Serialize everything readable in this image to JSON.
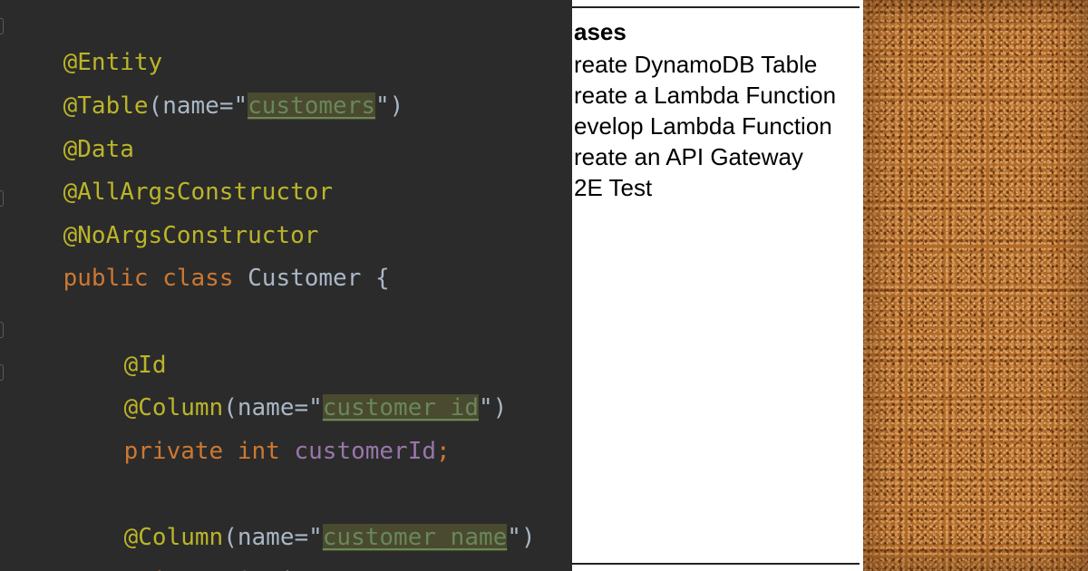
{
  "editor": {
    "lines": {
      "l1": {
        "ann": "@Entity"
      },
      "l2": {
        "ann": "@Table",
        "open": "(name=\"",
        "value": "customers",
        "close": "\")"
      },
      "l3": {
        "ann": "@Data"
      },
      "l4": {
        "ann": "@AllArgsConstructor"
      },
      "l5": {
        "ann": "@NoArgsConstructor"
      },
      "l6": {
        "kw1": "public",
        "kw2": "class",
        "name": "Customer",
        "brace": "{"
      },
      "l7": {
        "ann": "@Id"
      },
      "l8": {
        "ann": "@Column",
        "open": "(name=\"",
        "value": "customer_id",
        "close": "\")"
      },
      "l9": {
        "kw1": "private",
        "kw2": "int",
        "field": "customerId",
        "end": ";"
      },
      "l10": {
        "ann": "@Column",
        "open": "(name=\"",
        "value": "customer_name",
        "close": "\")"
      },
      "l11": {
        "kw1": "private",
        "type": "String",
        "field": "customerName",
        "end": ";"
      }
    }
  },
  "slide": {
    "title": "ases",
    "items": [
      "reate DynamoDB Table",
      "reate a Lambda Function",
      "evelop Lambda Function",
      "reate an API Gateway",
      "2E Test"
    ]
  },
  "colors": {
    "editor_bg": "#2b2b2b",
    "annotation": "#bbb529",
    "keyword": "#cc7832",
    "field": "#9876aa",
    "string": "#6a8759",
    "default_text": "#a9b7c6",
    "cork": "#b06a2a"
  }
}
